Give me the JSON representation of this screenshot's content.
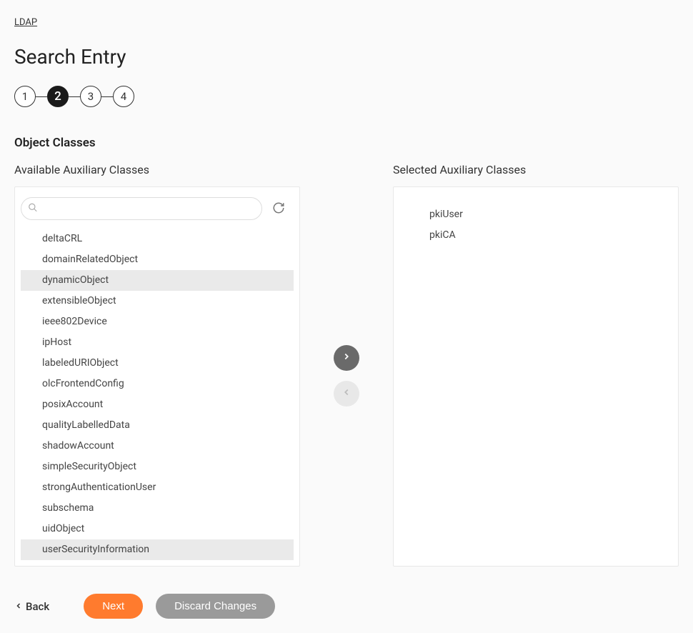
{
  "breadcrumb": "LDAP",
  "page_title": "Search Entry",
  "wizard": {
    "steps": [
      "1",
      "2",
      "3",
      "4"
    ],
    "active_index": 1
  },
  "section_title": "Object Classes",
  "available": {
    "label": "Available Auxiliary Classes",
    "search_placeholder": "",
    "items": [
      {
        "name": "deltaCRL",
        "highlighted": false
      },
      {
        "name": "domainRelatedObject",
        "highlighted": false
      },
      {
        "name": "dynamicObject",
        "highlighted": true
      },
      {
        "name": "extensibleObject",
        "highlighted": false
      },
      {
        "name": "ieee802Device",
        "highlighted": false
      },
      {
        "name": "ipHost",
        "highlighted": false
      },
      {
        "name": "labeledURIObject",
        "highlighted": false
      },
      {
        "name": "olcFrontendConfig",
        "highlighted": false
      },
      {
        "name": "posixAccount",
        "highlighted": false
      },
      {
        "name": "qualityLabelledData",
        "highlighted": false
      },
      {
        "name": "shadowAccount",
        "highlighted": false
      },
      {
        "name": "simpleSecurityObject",
        "highlighted": false
      },
      {
        "name": "strongAuthenticationUser",
        "highlighted": false
      },
      {
        "name": "subschema",
        "highlighted": false
      },
      {
        "name": "uidObject",
        "highlighted": false
      },
      {
        "name": "userSecurityInformation",
        "highlighted": true
      }
    ]
  },
  "selected": {
    "label": "Selected Auxiliary Classes",
    "items": [
      {
        "name": "pkiUser"
      },
      {
        "name": "pkiCA"
      }
    ]
  },
  "transfer": {
    "add_enabled": true,
    "remove_enabled": false
  },
  "footer": {
    "back_label": "Back",
    "next_label": "Next",
    "discard_label": "Discard Changes"
  }
}
